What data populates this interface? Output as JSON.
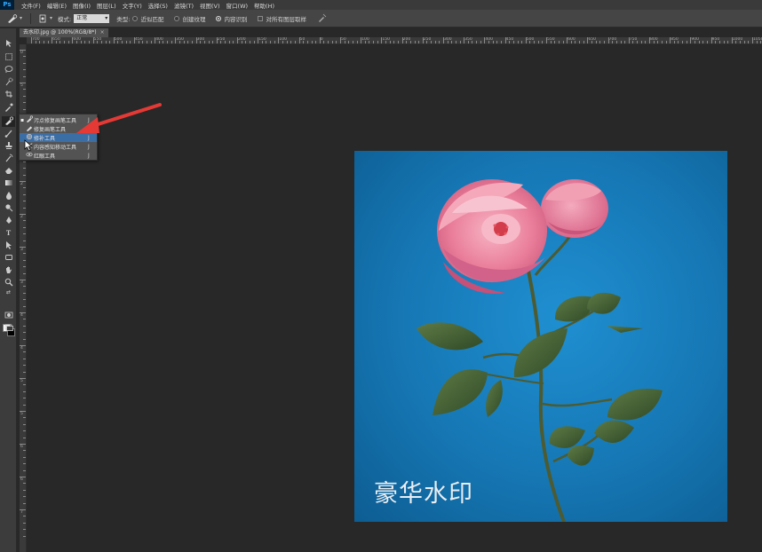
{
  "app": {
    "logo": "Ps"
  },
  "menu": [
    "文件(F)",
    "编辑(E)",
    "图像(I)",
    "图层(L)",
    "文字(Y)",
    "选择(S)",
    "滤镜(T)",
    "视图(V)",
    "窗口(W)",
    "帮助(H)"
  ],
  "options": {
    "mode_label": "模式:",
    "mode_value": "正常",
    "type_label": "类型:",
    "type_options": [
      {
        "label": "近似匹配",
        "checked": false
      },
      {
        "label": "创建纹理",
        "checked": false
      },
      {
        "label": "内容识别",
        "checked": true
      }
    ],
    "sample_all_label": "对所有图层取样"
  },
  "document": {
    "tab_title": "去水印.jpg @ 100%(RGB/8*)",
    "close_glyph": "×"
  },
  "ruler": {
    "h_labels": [
      "700",
      "650",
      "600",
      "550",
      "500",
      "450",
      "400",
      "350",
      "300",
      "250",
      "200",
      "150",
      "100",
      "50",
      "0",
      "50",
      "100",
      "150",
      "200",
      "250",
      "300",
      "350",
      "400",
      "450",
      "500",
      "550",
      "600",
      "650",
      "700",
      "750",
      "800",
      "850",
      "900",
      "950",
      "1000",
      "1050",
      "1100"
    ],
    "v_labels": [
      "0",
      "5",
      "1",
      "1",
      "2",
      "2",
      "3",
      "3",
      "4",
      "4",
      "5",
      "5",
      "6",
      "6",
      "7"
    ]
  },
  "flyout": {
    "items": [
      {
        "icon": "spot-healing-icon",
        "label": "污点修复画笔工具",
        "key": "J",
        "selected": false
      },
      {
        "icon": "healing-brush-icon",
        "label": "修复画笔工具",
        "key": "J",
        "selected": false
      },
      {
        "icon": "patch-icon",
        "label": "修补工具",
        "key": "J",
        "selected": true
      },
      {
        "icon": "content-aware-move-icon",
        "label": "内容感知移动工具",
        "key": "J",
        "selected": false
      },
      {
        "icon": "red-eye-icon",
        "label": "红眼工具",
        "key": "J",
        "selected": false
      }
    ]
  },
  "canvas": {
    "watermark_text": "豪华水印",
    "background_color": "#1677b4"
  },
  "colors": {
    "foreground": "#ffffff",
    "background": "#000000",
    "annotation_arrow": "#e53935",
    "selection": "#3c6ea6"
  }
}
